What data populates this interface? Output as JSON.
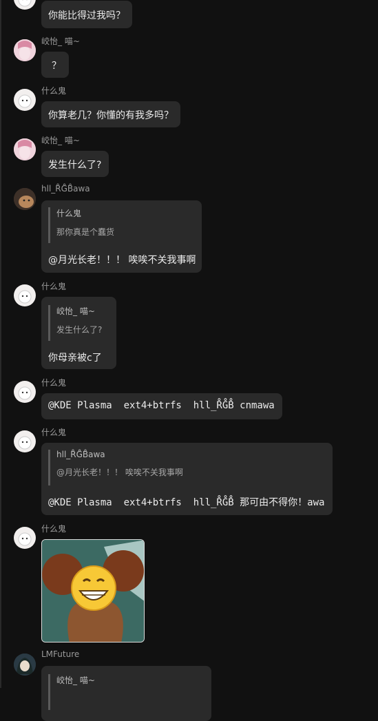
{
  "messages": [
    {
      "text": "你能比得过我吗？"
    },
    {
      "sender": "峧怡_ 喵~",
      "text": "？"
    },
    {
      "sender": "什么鬼",
      "text": "你算老几？你懂的有我多吗？"
    },
    {
      "sender": "峧怡_ 喵~",
      "text": "发生什么了?"
    },
    {
      "sender": "hll_R̊G̊B̊awa",
      "quote": {
        "name": "什么鬼",
        "text": "那你真是个蠢货"
      },
      "text": "@月光长老！！！ 唉唉不关我事啊"
    },
    {
      "sender": "什么鬼",
      "quote": {
        "name": "峧怡_ 喵~",
        "text": "发生什么了?"
      },
      "text": "你母亲被c了"
    },
    {
      "sender": "什么鬼",
      "text": "@KDE Plasma  ext4+btrfs  hll_R̊G̊B̊ cnmawa"
    },
    {
      "sender": "什么鬼",
      "quote": {
        "name": "hll_R̊G̊B̊awa",
        "text": "@月光长老！！！ 唉唉不关我事啊"
      },
      "text": "@KDE Plasma  ext4+btrfs  hll_R̊G̊B̊ 那可由不得你！awa"
    },
    {
      "sender": "什么鬼",
      "sticker": "grinning-mouse-sticker"
    },
    {
      "sender": "LMFuture",
      "quote": {
        "name": "峧怡_ 喵~"
      }
    }
  ]
}
